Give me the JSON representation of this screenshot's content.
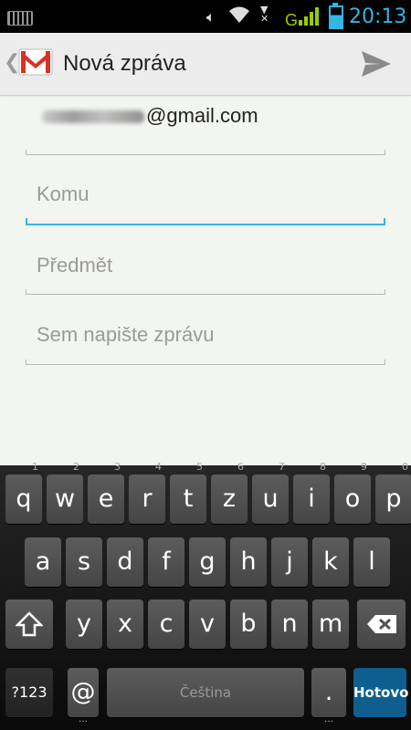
{
  "status_bar": {
    "time": "20:13",
    "network_label": "G"
  },
  "action_bar": {
    "title": "Nová zpráva"
  },
  "compose": {
    "from_domain": "@gmail.com",
    "to_placeholder": "Komu",
    "subject_placeholder": "Předmět",
    "body_placeholder": "Sem napište zprávu"
  },
  "keyboard": {
    "row1": [
      {
        "k": "q",
        "h": "1"
      },
      {
        "k": "w",
        "h": "2"
      },
      {
        "k": "e",
        "h": "3"
      },
      {
        "k": "r",
        "h": "4"
      },
      {
        "k": "t",
        "h": "5"
      },
      {
        "k": "z",
        "h": "6"
      },
      {
        "k": "u",
        "h": "7"
      },
      {
        "k": "i",
        "h": "8"
      },
      {
        "k": "o",
        "h": "9"
      },
      {
        "k": "p",
        "h": "0"
      }
    ],
    "row2": [
      "a",
      "s",
      "d",
      "f",
      "g",
      "h",
      "j",
      "k",
      "l"
    ],
    "row3": [
      "y",
      "x",
      "c",
      "v",
      "b",
      "n",
      "m"
    ],
    "mode_label": "?123",
    "at_label": "@",
    "space_label": "Čeština",
    "period_label": ".",
    "done_label": "Hotovo"
  },
  "colors": {
    "accent": "#33b5e5",
    "background": "#f3f5f1",
    "keyboard_bg": "#111111",
    "done_key": "#0e5f8e"
  }
}
